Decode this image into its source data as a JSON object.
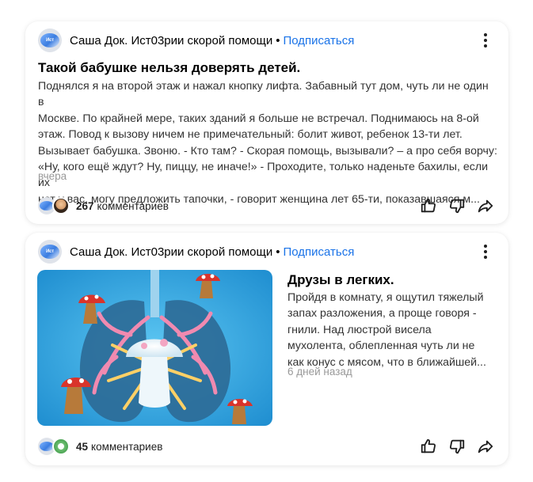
{
  "posts": [
    {
      "channel": "Саша Док. Ист03рии скорой помощи",
      "separator": "•",
      "subscribe": "Подписаться",
      "title": "Такой бабушке нельзя доверять детей.",
      "excerpt_lines": [
        "Поднялся я на второй этаж и нажал кнопку лифта. Забавный тут дом, чуть ли не один в",
        "Москве. По крайней мере, таких зданий я больше не встречал. Поднимаюсь на 8-ой",
        "этаж. Повод к вызову ничем не примечательный: болит живот, ребенок 13-ти лет.",
        "Вызывает бабушка. Звоню. - Кто там? - Скорая помощь, вызывали? – а про себя ворчу:",
        "«Ну, кого ещё ждут? Ну, пиццу, не иначе!» - Проходите, только наденьте бахилы, если их",
        "нет у вас, могу предложить тапочки, - говорит женщина лет 65-ти, показавшаяся м..."
      ],
      "date": "вчера",
      "comments_count": "267",
      "comments_word": "комментариев"
    },
    {
      "channel": "Саша Док. Ист03рии скорой помощи",
      "separator": "•",
      "subscribe": "Подписаться",
      "title": "Друзы в легких.",
      "excerpt_lines": [
        "Пройдя в комнату, я ощутил тяжелый",
        "запах разложения, а проще говоря -",
        "гнили. Над люстрой висела",
        "мухолента, облепленная чуть ли не",
        "как конус с мясом, что в ближайшей..."
      ],
      "date": "6 дней назад",
      "comments_count": "45",
      "comments_word": "комментариев"
    }
  ],
  "icons": {
    "more": "more-vertical-icon",
    "like": "thumbs-up-icon",
    "dislike": "thumbs-down-icon",
    "share": "share-arrow-icon"
  },
  "colors": {
    "accent": "#1a73e8",
    "thumb_bg": "#2f9ed8"
  }
}
